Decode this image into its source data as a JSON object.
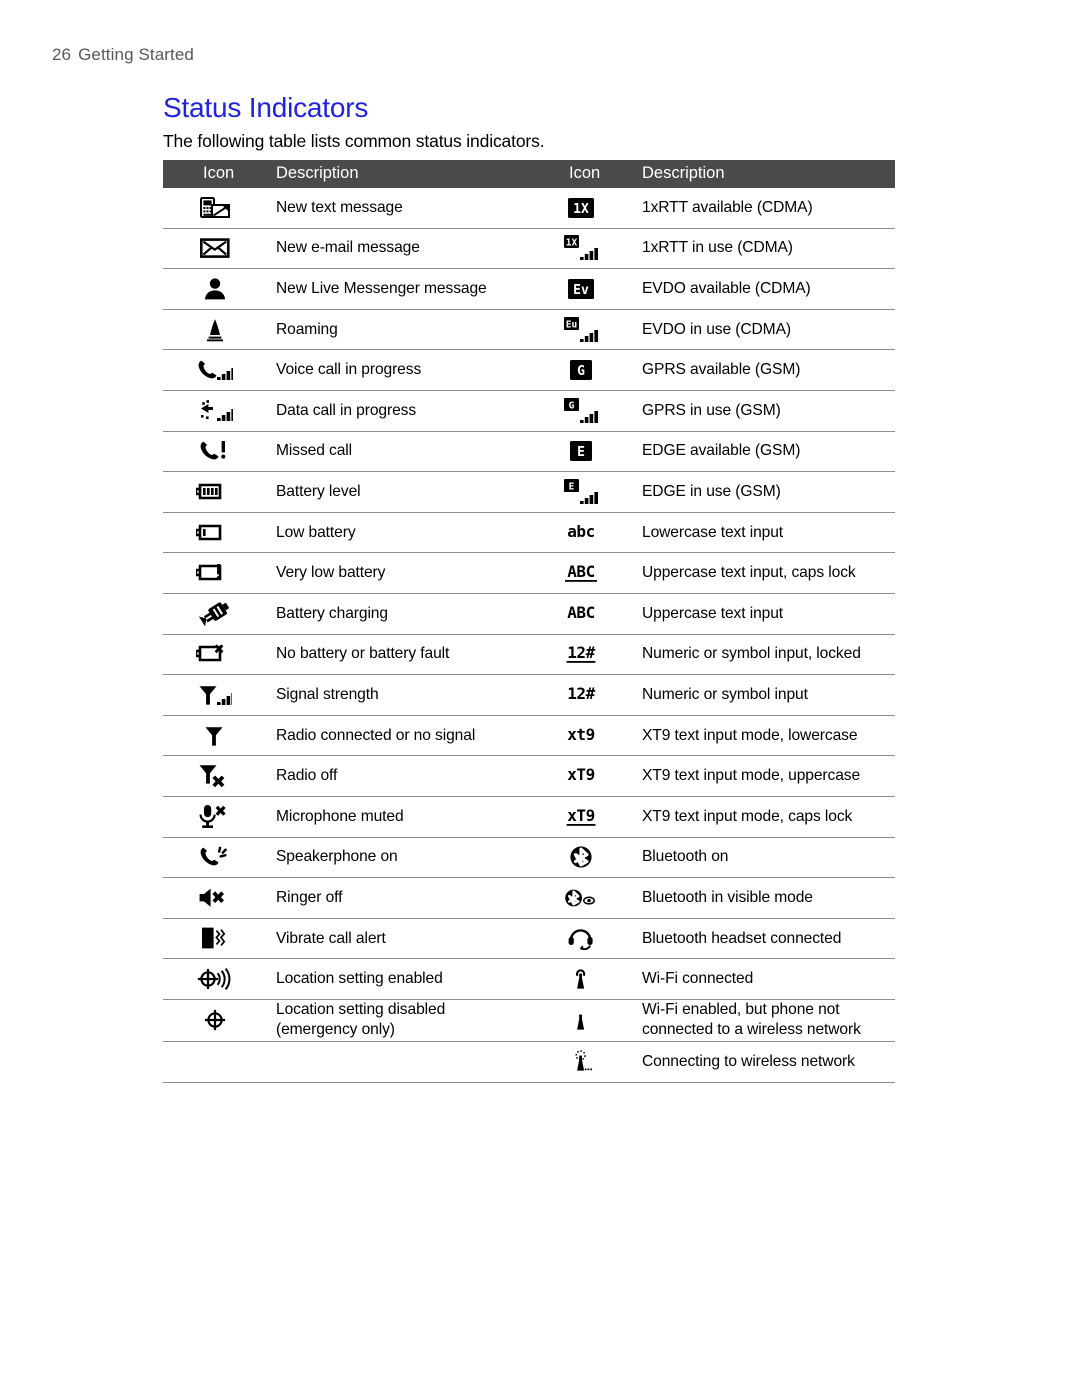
{
  "header": {
    "page_number": "26",
    "section": "Getting Started"
  },
  "title": "Status Indicators",
  "intro": "The following table lists common status indicators.",
  "colors": {
    "title": "#2222dd",
    "table_header_bg": "#4a4a4c",
    "table_header_text": "#ffffff",
    "rule": "#8e8e90",
    "running_header": "#58585a"
  },
  "table": {
    "columns": [
      "Icon",
      "Description",
      "Icon",
      "Description"
    ],
    "rows": [
      {
        "left": {
          "icon": "new-text-message-icon",
          "description": "New text message"
        },
        "right": {
          "icon": "1xrtt-available-icon",
          "description": "1xRTT available (CDMA)"
        }
      },
      {
        "left": {
          "icon": "new-email-message-icon",
          "description": "New e-mail message"
        },
        "right": {
          "icon": "1xrtt-in-use-icon",
          "description": "1xRTT in use (CDMA)"
        }
      },
      {
        "left": {
          "icon": "new-live-messenger-message-icon",
          "description": "New Live Messenger message"
        },
        "right": {
          "icon": "evdo-available-icon",
          "description": "EVDO available (CDMA)"
        }
      },
      {
        "left": {
          "icon": "roaming-icon",
          "description": "Roaming"
        },
        "right": {
          "icon": "evdo-in-use-icon",
          "description": "EVDO in use (CDMA)"
        }
      },
      {
        "left": {
          "icon": "voice-call-in-progress-icon",
          "description": "Voice call in progress"
        },
        "right": {
          "icon": "gprs-available-icon",
          "description": "GPRS available (GSM)"
        }
      },
      {
        "left": {
          "icon": "data-call-in-progress-icon",
          "description": "Data call in progress"
        },
        "right": {
          "icon": "gprs-in-use-icon",
          "description": "GPRS in use (GSM)"
        }
      },
      {
        "left": {
          "icon": "missed-call-icon",
          "description": "Missed call"
        },
        "right": {
          "icon": "edge-available-icon",
          "description": "EDGE available (GSM)"
        }
      },
      {
        "left": {
          "icon": "battery-level-icon",
          "description": "Battery level"
        },
        "right": {
          "icon": "edge-in-use-icon",
          "description": "EDGE in use (GSM)"
        }
      },
      {
        "left": {
          "icon": "low-battery-icon",
          "description": "Low battery"
        },
        "right": {
          "icon": "lowercase-text-input-icon",
          "description": "Lowercase text input"
        }
      },
      {
        "left": {
          "icon": "very-low-battery-icon",
          "description": "Very low battery"
        },
        "right": {
          "icon": "uppercase-caps-lock-icon",
          "description": "Uppercase text input, caps lock"
        }
      },
      {
        "left": {
          "icon": "battery-charging-icon",
          "description": "Battery charging"
        },
        "right": {
          "icon": "uppercase-text-input-icon",
          "description": "Uppercase text input"
        }
      },
      {
        "left": {
          "icon": "no-battery-fault-icon",
          "description": "No battery or battery fault"
        },
        "right": {
          "icon": "numeric-symbol-locked-icon",
          "description": "Numeric or symbol input, locked"
        }
      },
      {
        "left": {
          "icon": "signal-strength-icon",
          "description": "Signal strength"
        },
        "right": {
          "icon": "numeric-symbol-input-icon",
          "description": "Numeric or symbol input"
        }
      },
      {
        "left": {
          "icon": "radio-connected-no-signal-icon",
          "description": "Radio connected or no signal"
        },
        "right": {
          "icon": "xt9-lowercase-icon",
          "description": "XT9 text input mode, lowercase"
        }
      },
      {
        "left": {
          "icon": "radio-off-icon",
          "description": "Radio off"
        },
        "right": {
          "icon": "xt9-uppercase-icon",
          "description": "XT9 text input mode, uppercase"
        }
      },
      {
        "left": {
          "icon": "microphone-muted-icon",
          "description": "Microphone muted"
        },
        "right": {
          "icon": "xt9-caps-lock-icon",
          "description": "XT9 text input mode, caps lock"
        }
      },
      {
        "left": {
          "icon": "speakerphone-on-icon",
          "description": "Speakerphone on"
        },
        "right": {
          "icon": "bluetooth-on-icon",
          "description": "Bluetooth on"
        }
      },
      {
        "left": {
          "icon": "ringer-off-icon",
          "description": "Ringer off"
        },
        "right": {
          "icon": "bluetooth-visible-icon",
          "description": "Bluetooth in visible mode"
        }
      },
      {
        "left": {
          "icon": "vibrate-call-alert-icon",
          "description": "Vibrate call alert"
        },
        "right": {
          "icon": "bluetooth-headset-icon",
          "description": "Bluetooth headset connected"
        }
      },
      {
        "left": {
          "icon": "location-enabled-icon",
          "description": "Location setting enabled"
        },
        "right": {
          "icon": "wifi-connected-icon",
          "description": "Wi-Fi connected"
        }
      },
      {
        "left": {
          "icon": "location-disabled-icon",
          "description": "Location setting disabled (emergency only)"
        },
        "right": {
          "icon": "wifi-enabled-not-connected-icon",
          "description": "Wi-Fi enabled, but phone not connected to a wireless network"
        }
      },
      {
        "left": {
          "icon": "",
          "description": ""
        },
        "right": {
          "icon": "connecting-wireless-icon",
          "description": "Connecting to wireless network"
        }
      }
    ]
  }
}
